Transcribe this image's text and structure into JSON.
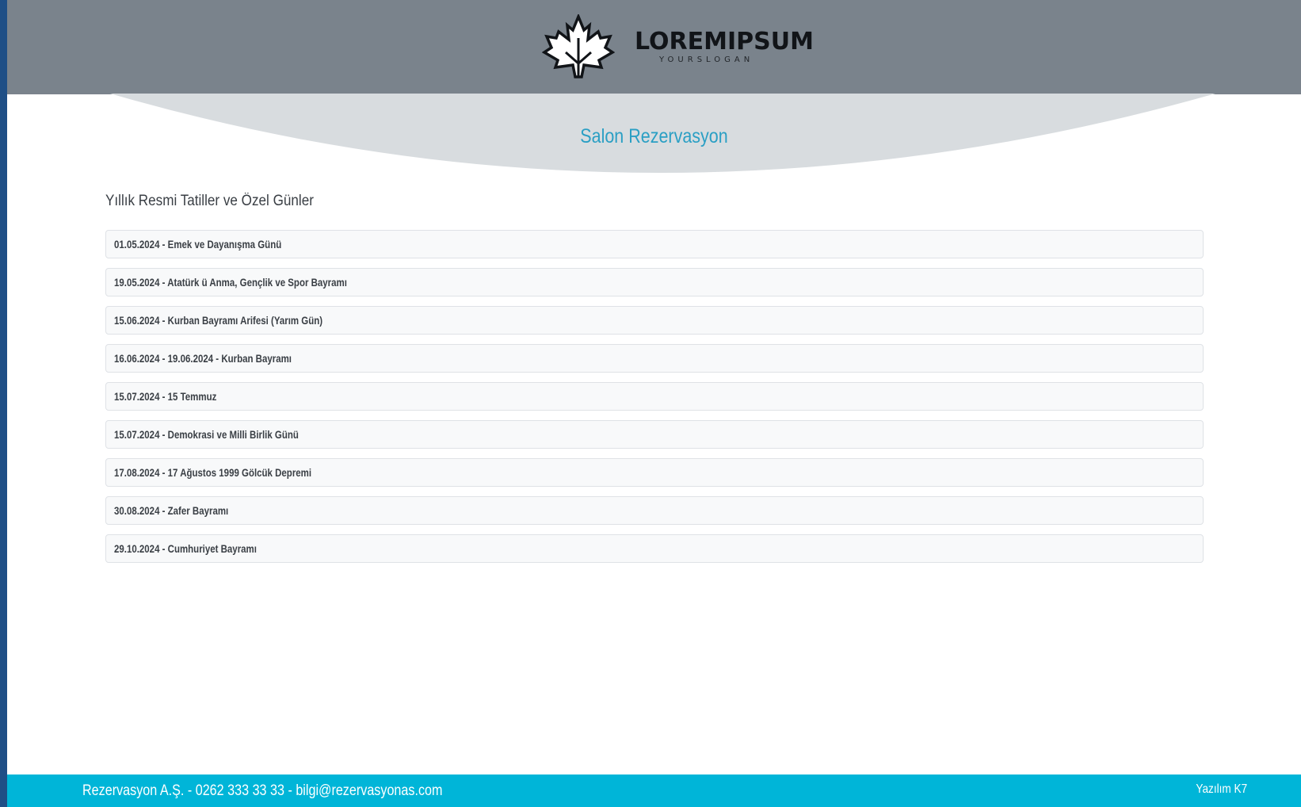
{
  "header": {
    "logo_text": "LOREMIPSUM",
    "logo_slogan": "YOURSLOGAN",
    "logo_icon": "maple-leaf-icon"
  },
  "app_title": "Salon Rezervasyon",
  "holidays": {
    "title": "Yıllık Resmi Tatiller ve Özel Günler",
    "items": [
      "01.05.2024 - Emek ve Dayanışma Günü",
      "19.05.2024 - Atatürk ü Anma, Gençlik ve Spor Bayramı",
      "15.06.2024 - Kurban Bayramı Arifesi (Yarım Gün)",
      "16.06.2024 - 19.06.2024 - Kurban Bayramı",
      "15.07.2024 - 15 Temmuz",
      "15.07.2024 - Demokrasi ve Milli Birlik Günü",
      "17.08.2024 - 17 Ağustos 1999 Gölcük Depremi",
      "30.08.2024 - Zafer Bayramı",
      "29.10.2024 - Cumhuriyet Bayramı"
    ]
  },
  "footer": {
    "contact": "Rezervasyon A.Ş. - 0262 333 33 33 - bilgi@rezervasyonas.com",
    "credit": "Yazılım K7"
  },
  "colors": {
    "header_bg": "#7a838c",
    "curve_bg": "#d8dcdf",
    "accent": "#2a9fc4",
    "footer_bg": "#00b5d8",
    "outer_bg": "#1f4f86"
  }
}
